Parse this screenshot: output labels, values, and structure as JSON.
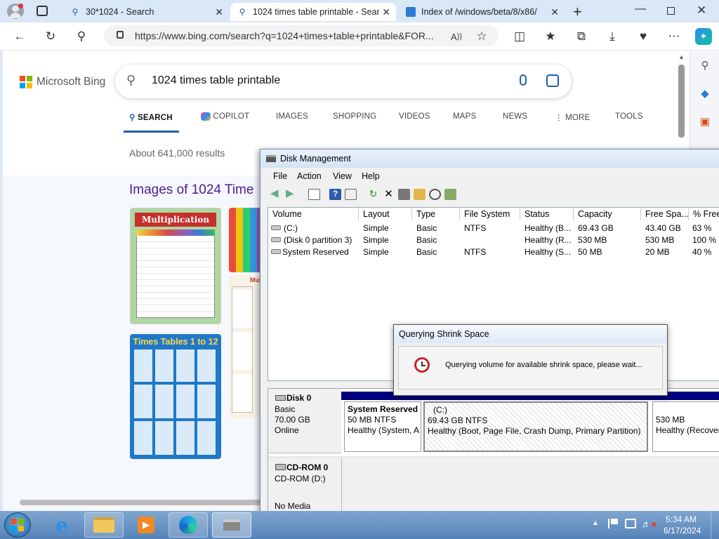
{
  "browser": {
    "tabs": [
      {
        "title": "30*1024 - Search",
        "active": false
      },
      {
        "title": "1024 times table printable - Sear",
        "active": true
      },
      {
        "title": "Index of /windows/beta/8/x86/",
        "active": false
      }
    ],
    "url": "https://www.bing.com/search?q=1024+times+table+printable&FOR..."
  },
  "bing": {
    "logo_text": "Microsoft Bing",
    "query": "1024 times table printable",
    "nav": {
      "search": "SEARCH",
      "copilot": "COPILOT",
      "images": "IMAGES",
      "shopping": "SHOPPING",
      "videos": "VIDEOS",
      "maps": "MAPS",
      "news": "NEWS",
      "more": "MORE",
      "tools": "TOOLS"
    },
    "result_count": "About 641,000 results",
    "images_heading": "Images of 1024 Time",
    "thumb1_title": "Multiplication",
    "thumb2_title": "Times Tables 1 to 12",
    "thumb3_title": "Multi"
  },
  "disk_mgmt": {
    "title": "Disk Management",
    "menu": {
      "file": "File",
      "action": "Action",
      "view": "View",
      "help": "Help"
    },
    "columns": [
      "Volume",
      "Layout",
      "Type",
      "File System",
      "Status",
      "Capacity",
      "Free Spa...",
      "% Free"
    ],
    "rows": [
      {
        "volume": "(C:)",
        "layout": "Simple",
        "type": "Basic",
        "fs": "NTFS",
        "status": "Healthy (B...",
        "capacity": "69.43 GB",
        "free": "43.40 GB",
        "pct": "63 %"
      },
      {
        "volume": "(Disk 0 partition 3)",
        "layout": "Simple",
        "type": "Basic",
        "fs": "",
        "status": "Healthy (R...",
        "capacity": "530 MB",
        "free": "530 MB",
        "pct": "100 %"
      },
      {
        "volume": "System Reserved",
        "layout": "Simple",
        "type": "Basic",
        "fs": "NTFS",
        "status": "Healthy (S...",
        "capacity": "50 MB",
        "free": "20 MB",
        "pct": "40 %"
      }
    ],
    "disk0": {
      "name": "Disk 0",
      "type": "Basic",
      "size": "70.00 GB",
      "state": "Online"
    },
    "partitions": {
      "sysres": {
        "name": "System Reserved",
        "size": "50 MB NTFS",
        "status": "Healthy (System, A"
      },
      "c": {
        "name": "(C:)",
        "size": "69.43 GB NTFS",
        "status": "Healthy (Boot, Page File, Crash Dump, Primary Partition)"
      },
      "rec": {
        "size": "530 MB",
        "status": "Healthy (Recover"
      }
    },
    "cdrom": {
      "name": "CD-ROM 0",
      "label": "CD-ROM (D:)",
      "media": "No Media"
    }
  },
  "dialog": {
    "title": "Querying Shrink Space",
    "message": "Querying volume for available shrink space, please wait..."
  },
  "taskbar": {
    "time": "5:34 AM",
    "date": "6/17/2024"
  },
  "colors": {
    "accent": "#1a5fb4",
    "volume_bar": "#00007f",
    "bing_purple": "#4b1d95"
  }
}
